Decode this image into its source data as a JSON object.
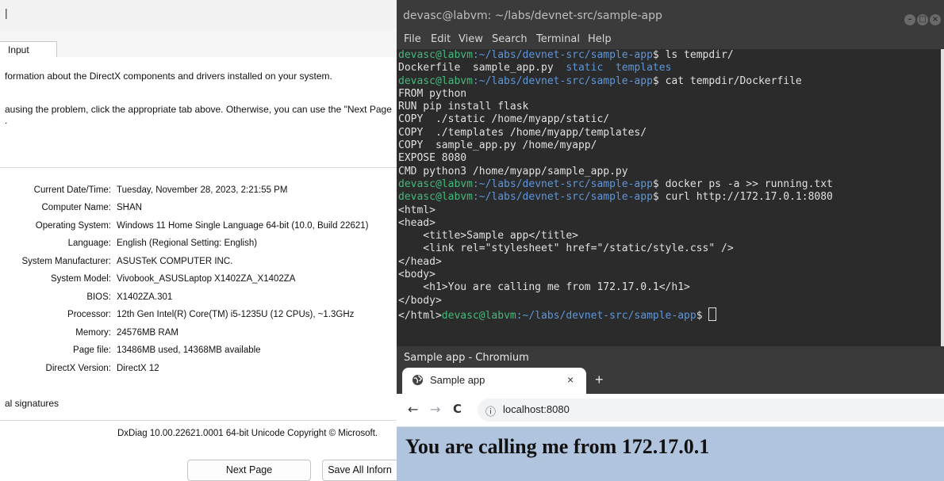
{
  "dxdiag": {
    "title_fragment": "|",
    "active_tab": "Input",
    "intro_text": "formation about the DirectX components and drivers installed on your system.",
    "help_line1": "ausing the problem, click the appropriate tab above.  Otherwise, you can use the \"Next Page",
    "help_line2": ".",
    "system_info": [
      {
        "label": "Current Date/Time:",
        "value": "Tuesday, November 28, 2023, 2:21:55 PM"
      },
      {
        "label": "Computer Name:",
        "value": "SHAN"
      },
      {
        "label": "Operating System:",
        "value": "Windows 11 Home Single Language 64-bit (10.0, Build 22621)"
      },
      {
        "label": "Language:",
        "value": "English (Regional Setting: English)"
      },
      {
        "label": "System Manufacturer:",
        "value": "ASUSTeK COMPUTER INC."
      },
      {
        "label": "System Model:",
        "value": "Vivobook_ASUSLaptop X1402ZA_X1402ZA"
      },
      {
        "label": "BIOS:",
        "value": "X1402ZA.301"
      },
      {
        "label": "Processor:",
        "value": "12th Gen Intel(R) Core(TM) i5-1235U (12 CPUs), ~1.3GHz"
      },
      {
        "label": "Memory:",
        "value": "24576MB RAM"
      },
      {
        "label": "Page file:",
        "value": "13486MB used, 14368MB available"
      },
      {
        "label": "DirectX Version:",
        "value": "DirectX 12"
      }
    ],
    "signatures_text": "al signatures",
    "footer_text": "DxDiag 10.00.22621.0001 64-bit Unicode  Copyright © Microsoft.",
    "next_page_label": "Next Page",
    "save_all_label": "Save All Inforn"
  },
  "terminal": {
    "title": "devasc@labvm: ~/labs/devnet-src/sample-app",
    "menu": [
      "File",
      "Edit",
      "View",
      "Search",
      "Terminal",
      "Help"
    ],
    "prompt_user": "devasc@labvm",
    "prompt_path": ":~/labs/devnet-src/sample-app",
    "prompt_symbol": "$ ",
    "cmd_ls": "ls tempdir/",
    "ls_file1": "Dockerfile  sample_app.py  ",
    "ls_dir1": "static",
    "ls_sep": "  ",
    "ls_dir2": "templates",
    "cmd_cat": "cat tempdir/Dockerfile",
    "dockerfile_lines": [
      "FROM python",
      "RUN pip install flask",
      "COPY  ./static /home/myapp/static/",
      "COPY  ./templates /home/myapp/templates/",
      "COPY  sample_app.py /home/myapp/",
      "EXPOSE 8080",
      "CMD python3 /home/myapp/sample_app.py"
    ],
    "cmd_docker": "docker ps -a >> running.txt",
    "cmd_curl": "curl http://172.17.0.1:8080",
    "curl_lines": [
      "<html>",
      "<head>",
      "    <title>Sample app</title>",
      "    <link rel=\"stylesheet\" href=\"/static/style.css\" />",
      "</head>",
      "<body>",
      "    <h1>You are calling me from 172.17.0.1</h1>",
      "</body>"
    ],
    "curl_last": "</html>"
  },
  "browser": {
    "window_title": "Sample app - Chromium",
    "tab_title": "Sample app",
    "tab_close": "×",
    "new_tab": "+",
    "back": "←",
    "forward": "→",
    "reload": "C",
    "info_icon": "ⓘ",
    "url": "localhost:8080",
    "page_heading": "You are calling me from 172.17.0.1",
    "page_bg_color": "#b0c4de"
  }
}
